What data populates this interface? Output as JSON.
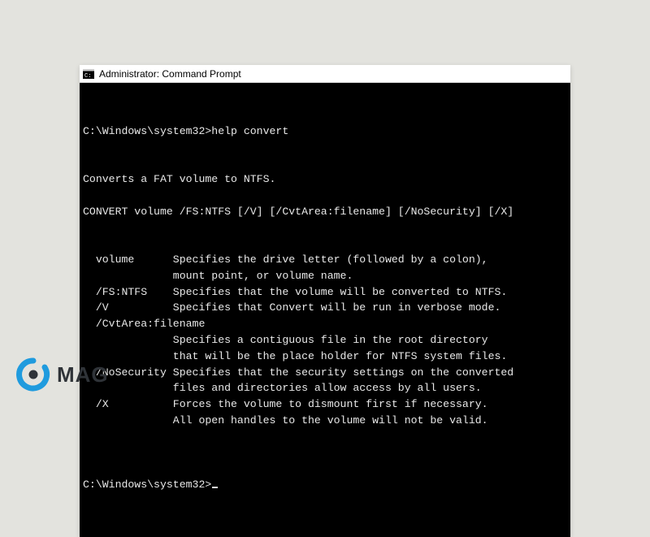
{
  "window": {
    "title": "Administrator: Command Prompt"
  },
  "terminal": {
    "prompt1": "C:\\Windows\\system32>",
    "command1": "help convert",
    "output": [
      "Converts a FAT volume to NTFS.",
      "",
      "CONVERT volume /FS:NTFS [/V] [/CvtArea:filename] [/NoSecurity] [/X]",
      "",
      "",
      "  volume      Specifies the drive letter (followed by a colon),",
      "              mount point, or volume name.",
      "  /FS:NTFS    Specifies that the volume will be converted to NTFS.",
      "  /V          Specifies that Convert will be run in verbose mode.",
      "  /CvtArea:filename",
      "              Specifies a contiguous file in the root directory",
      "              that will be the place holder for NTFS system files.",
      "  /NoSecurity Specifies that the security settings on the converted",
      "              files and directories allow access by all users.",
      "  /X          Forces the volume to dismount first if necessary.",
      "              All open handles to the volume will not be valid.",
      ""
    ],
    "prompt2": "C:\\Windows\\system32>"
  },
  "logo": {
    "text": "MAG"
  }
}
